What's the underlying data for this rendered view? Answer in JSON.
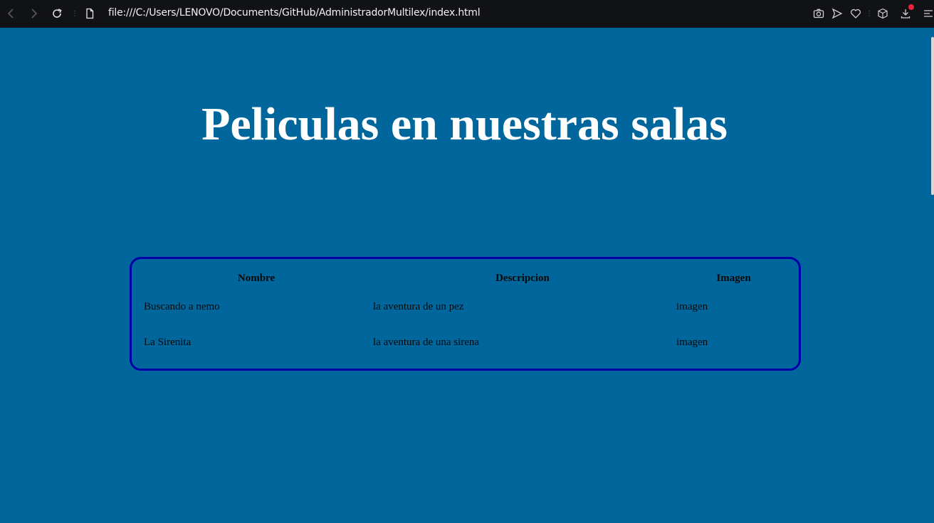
{
  "browser": {
    "url": "file:///C:/Users/LENOVO/Documents/GitHub/AdministradorMultilex/index.html"
  },
  "page": {
    "title": "Peliculas en nuestras salas"
  },
  "table": {
    "headers": [
      "Nombre",
      "Descripcion",
      "Imagen"
    ],
    "rows": [
      [
        "Buscando a nemo",
        "la aventura de un pez",
        "imagen"
      ],
      [
        "La Sirenita",
        "la aventura de una sirena",
        "imagen"
      ]
    ]
  },
  "colors": {
    "page_background": "#00669b",
    "browser_bar": "#111216",
    "table_border": "#0000a8",
    "title_text": "#ffffff",
    "notification_dot": "#e8243c"
  }
}
